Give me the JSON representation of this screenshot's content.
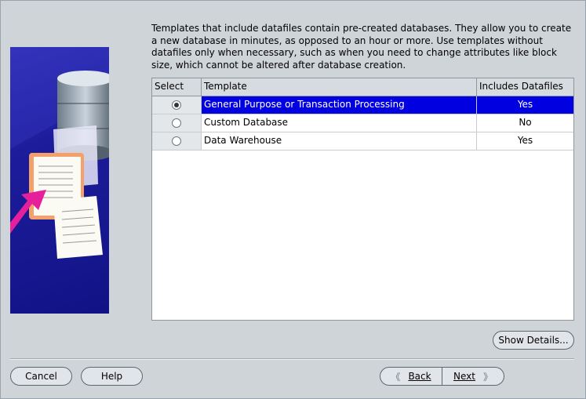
{
  "description": "Templates that include datafiles contain pre-created databases. They allow you to create a new database in minutes, as opposed to an hour or more. Use templates without datafiles only when necessary, such as when you need to change attributes like block size, which cannot be altered after database creation.",
  "table": {
    "headers": [
      "Select",
      "Template",
      "Includes Datafiles"
    ],
    "rows": [
      {
        "template": "General Purpose or Transaction Processing",
        "includes": "Yes",
        "selected": true
      },
      {
        "template": "Custom Database",
        "includes": "No",
        "selected": false
      },
      {
        "template": "Data Warehouse",
        "includes": "Yes",
        "selected": false
      }
    ]
  },
  "buttons": {
    "show_details": "Show Details...",
    "cancel": "Cancel",
    "help": "Help",
    "back": "Back",
    "next": "Next"
  },
  "colors": {
    "background": "#cfd4d9",
    "selection": "#0000e0",
    "illustration": "#1d1d9c"
  }
}
